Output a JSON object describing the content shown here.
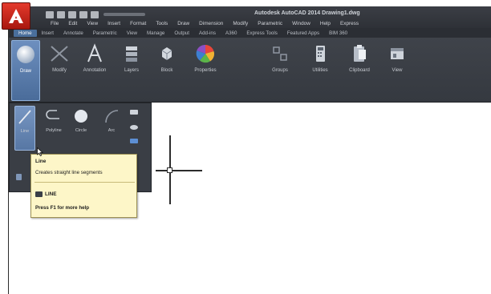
{
  "window": {
    "title": "Autodesk AutoCAD 2014   Drawing1.dwg"
  },
  "menubar": {
    "items": [
      "File",
      "Edit",
      "View",
      "Insert",
      "Format",
      "Tools",
      "Draw",
      "Dimension",
      "Modify",
      "Parametric",
      "Window",
      "Help",
      "Express"
    ]
  },
  "ribbon_tabs": {
    "items": [
      "Home",
      "Insert",
      "Annotate",
      "Parametric",
      "View",
      "Manage",
      "Output",
      "Add-ins",
      "A360",
      "Express Tools",
      "Featured Apps",
      "BIM 360"
    ],
    "active": "Home"
  },
  "ribbon": {
    "tools": [
      {
        "label": "Draw",
        "icon": "draw-sphere-icon"
      },
      {
        "label": "Modify",
        "icon": "modify-icon"
      },
      {
        "label": "Annotation",
        "icon": "annotation-icon"
      },
      {
        "label": "Layers",
        "icon": "layers-icon"
      },
      {
        "label": "Block",
        "icon": "block-icon"
      },
      {
        "label": "Properties",
        "icon": "properties-icon"
      },
      {
        "label": "Groups",
        "icon": "groups-icon"
      },
      {
        "label": "Utilities",
        "icon": "utilities-icon"
      },
      {
        "label": "Clipboard",
        "icon": "clipboard-icon"
      },
      {
        "label": "View",
        "icon": "view-icon"
      }
    ]
  },
  "draw_flyout": {
    "tools": [
      {
        "label": "Line",
        "icon": "line-icon"
      },
      {
        "label": "Polyline",
        "icon": "polyline-icon"
      },
      {
        "label": "Circle",
        "icon": "circle-icon"
      },
      {
        "label": "Arc",
        "icon": "arc-icon"
      }
    ]
  },
  "tooltip": {
    "title": "Line",
    "description": "Creates straight line segments",
    "command": "LINE",
    "help": "Press F1 for more help"
  },
  "colors": {
    "accent": "#4a6f9c",
    "app_red": "#d42a1e",
    "tooltip_bg": "#fdf6c8"
  }
}
